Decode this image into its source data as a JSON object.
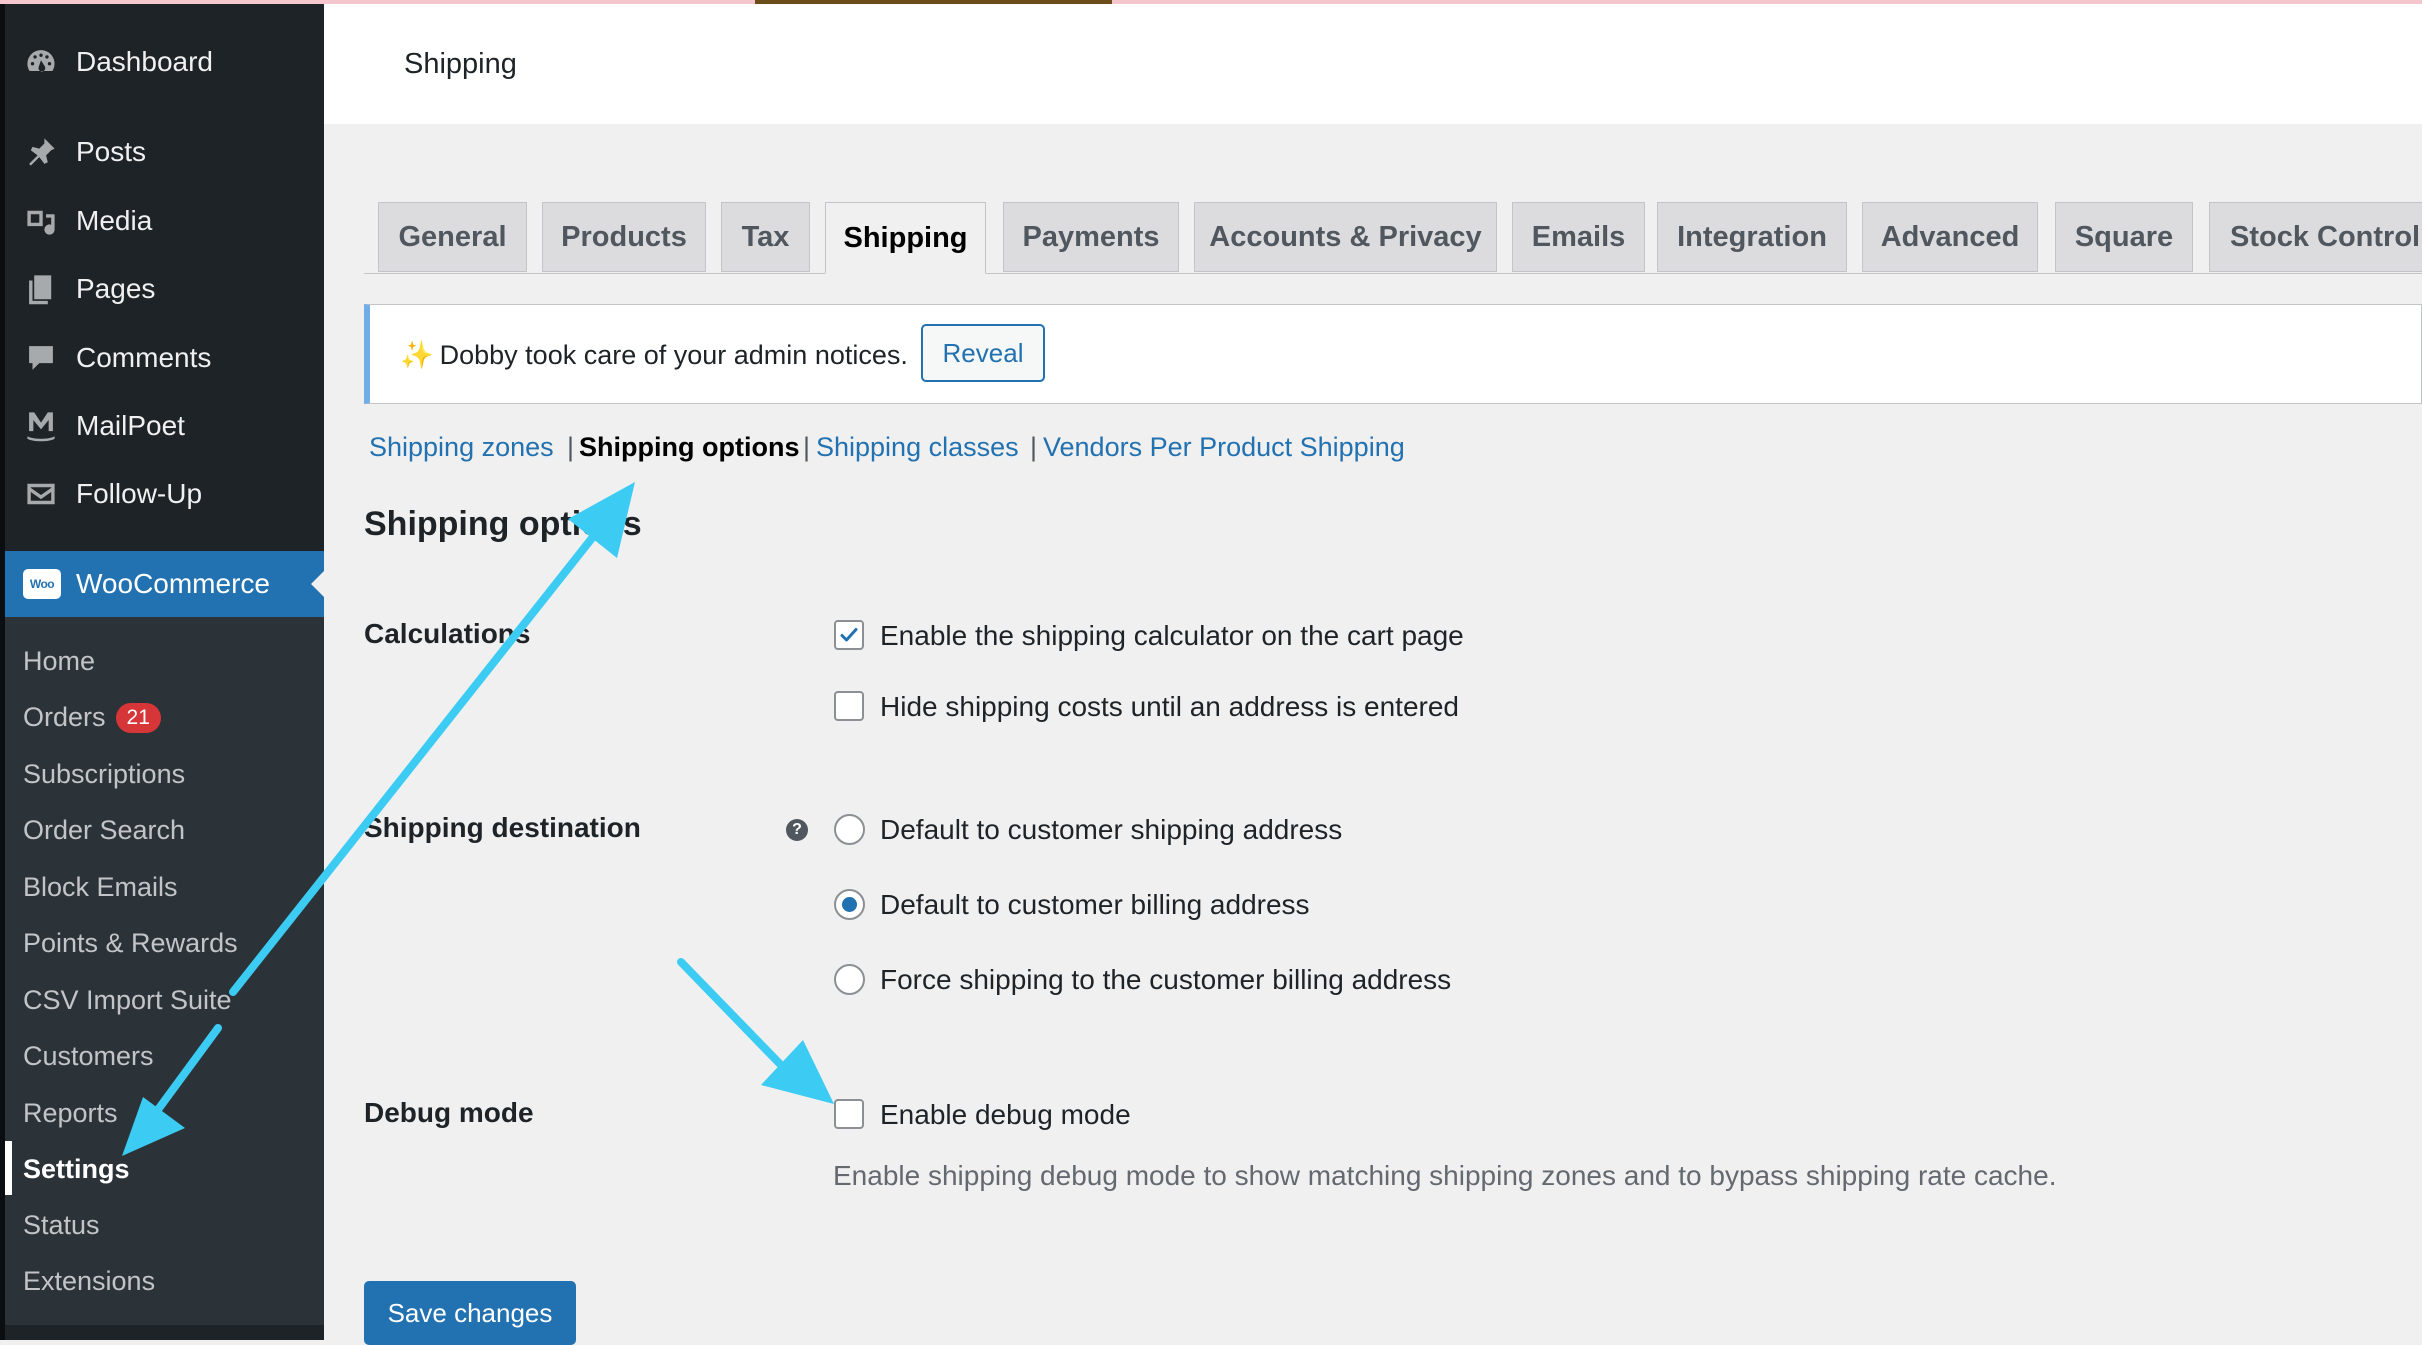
{
  "sidebar": {
    "menu": [
      {
        "label": "Dashboard",
        "icon": "dashboard-icon"
      },
      {
        "label": "Posts",
        "icon": "pin-icon"
      },
      {
        "label": "Media",
        "icon": "media-icon"
      },
      {
        "label": "Pages",
        "icon": "pages-icon"
      },
      {
        "label": "Comments",
        "icon": "comment-icon"
      },
      {
        "label": "MailPoet",
        "icon": "mailpoet-icon"
      },
      {
        "label": "Follow-Up",
        "icon": "envelope-icon"
      }
    ],
    "woocommerce": {
      "label": "WooCommerce",
      "logo": "Woo"
    },
    "submenu": [
      {
        "label": "Home"
      },
      {
        "label": "Orders",
        "badge": "21"
      },
      {
        "label": "Subscriptions"
      },
      {
        "label": "Order Search"
      },
      {
        "label": "Block Emails"
      },
      {
        "label": "Points & Rewards"
      },
      {
        "label": "CSV Import Suite"
      },
      {
        "label": "Customers"
      },
      {
        "label": "Reports"
      },
      {
        "label": "Settings",
        "active": true
      },
      {
        "label": "Status"
      },
      {
        "label": "Extensions"
      }
    ]
  },
  "header": {
    "title": "Shipping"
  },
  "tabs": [
    {
      "label": "General"
    },
    {
      "label": "Products"
    },
    {
      "label": "Tax"
    },
    {
      "label": "Shipping",
      "active": true
    },
    {
      "label": "Payments"
    },
    {
      "label": "Accounts & Privacy"
    },
    {
      "label": "Emails"
    },
    {
      "label": "Integration"
    },
    {
      "label": "Advanced"
    },
    {
      "label": "Square"
    },
    {
      "label": "Stock Control"
    }
  ],
  "notice": {
    "sparkle": "✨",
    "text": "Dobby took care of your admin notices.",
    "button": "Reveal"
  },
  "subnav": {
    "links": [
      "Shipping zones",
      "Shipping options",
      "Shipping classes",
      "Vendors Per Product Shipping"
    ],
    "separator": "|",
    "current": "Shipping options"
  },
  "form": {
    "title": "Shipping options",
    "calculations": {
      "label": "Calculations",
      "options": [
        {
          "label": "Enable the shipping calculator on the cart page",
          "checked": true
        },
        {
          "label": "Hide shipping costs until an address is entered",
          "checked": false
        }
      ]
    },
    "destination": {
      "label": "Shipping destination",
      "help": "?",
      "options": [
        {
          "label": "Default to customer shipping address",
          "selected": false
        },
        {
          "label": "Default to customer billing address",
          "selected": true
        },
        {
          "label": "Force shipping to the customer billing address",
          "selected": false
        }
      ]
    },
    "debug": {
      "label": "Debug mode",
      "option": {
        "label": "Enable debug mode",
        "checked": false
      },
      "description": "Enable shipping debug mode to show matching shipping zones and to bypass shipping rate cache."
    },
    "save_label": "Save changes"
  },
  "colors": {
    "sidebar_bg": "#1d2327",
    "submenu_bg": "#2c3338",
    "accent": "#2271b1",
    "annotation_arrow": "#3ccbf2",
    "badge": "#d63638"
  }
}
